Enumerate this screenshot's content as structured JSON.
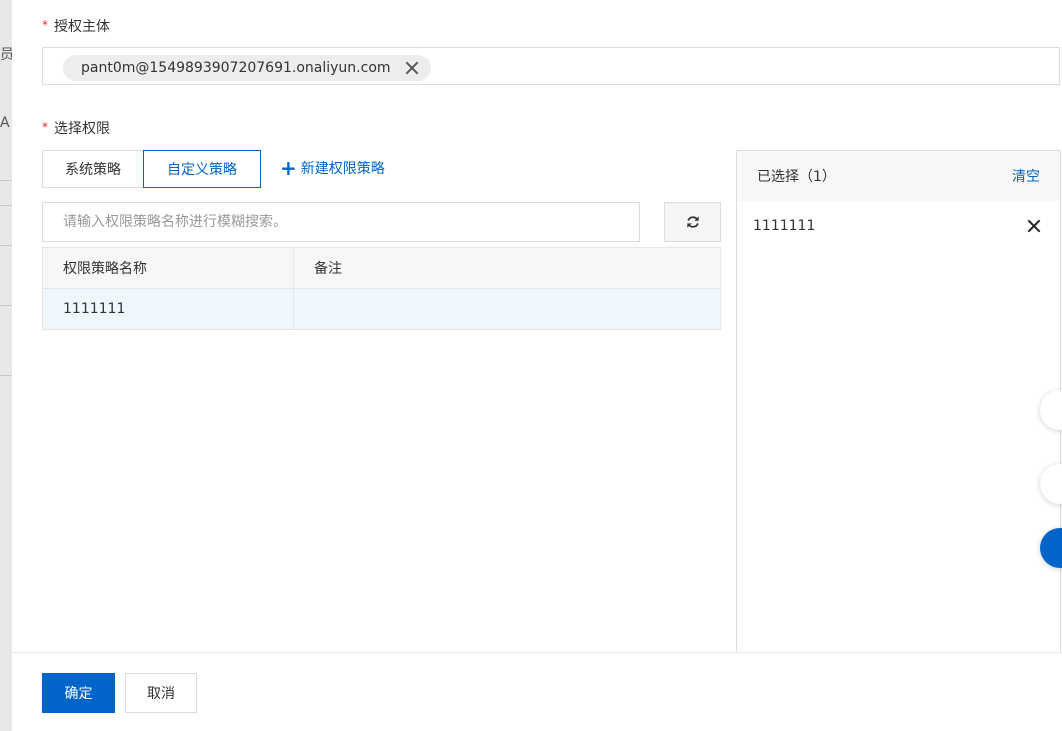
{
  "background_fragments": [
    "员",
    "A"
  ],
  "principal": {
    "label": "授权主体",
    "tag_value": "pant0m@1549893907207691.onaliyun.com"
  },
  "permission": {
    "label": "选择权限",
    "tabs": [
      "系统策略",
      "自定义策略"
    ],
    "active_tab": "自定义策略",
    "new_policy_label": "新建权限策略",
    "search_placeholder": "请输入权限策略名称进行模糊搜索。",
    "table": {
      "headers": [
        "权限策略名称",
        "备注"
      ],
      "rows": [
        {
          "name": "1111111",
          "note": ""
        }
      ]
    }
  },
  "selected_panel": {
    "title": "已选择（1）",
    "clear_label": "清空",
    "items": [
      "1111111"
    ]
  },
  "footer": {
    "ok_label": "确定",
    "cancel_label": "取消"
  },
  "colors": {
    "primary": "#0064c8",
    "required": "#d93026",
    "row_highlight": "#eff6fd"
  }
}
